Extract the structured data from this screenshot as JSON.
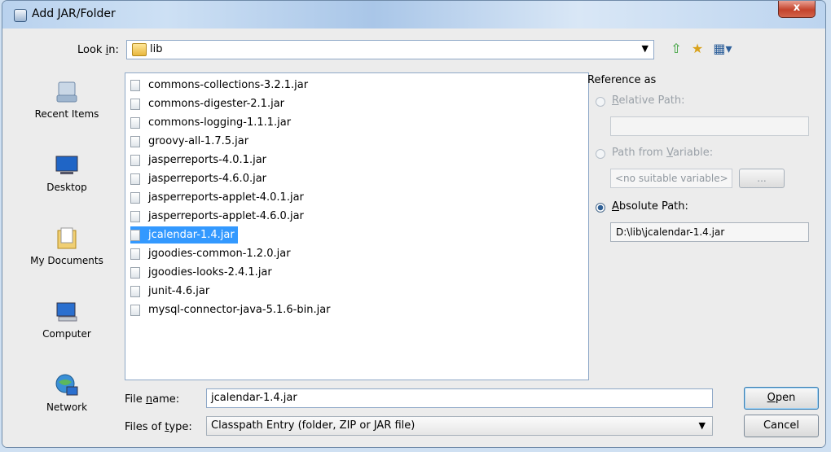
{
  "window": {
    "title": "Add JAR/Folder",
    "close_glyph": "x"
  },
  "lookin": {
    "label_prefix": "Look ",
    "label_key": "i",
    "label_suffix": "n:",
    "value": "lib",
    "arrow": "▼"
  },
  "toolbar": {
    "up_glyph": "⇧",
    "newfolder_glyph": "★",
    "view_glyph": "▦▾"
  },
  "places": [
    {
      "name": "recent-items",
      "label": "Recent Items"
    },
    {
      "name": "desktop",
      "label": "Desktop"
    },
    {
      "name": "my-documents",
      "label": "My Documents"
    },
    {
      "name": "computer",
      "label": "Computer"
    },
    {
      "name": "network",
      "label": "Network"
    }
  ],
  "files": [
    "commons-collections-3.2.1.jar",
    "commons-digester-2.1.jar",
    "commons-logging-1.1.1.jar",
    "groovy-all-1.7.5.jar",
    "jasperreports-4.0.1.jar",
    "jasperreports-4.6.0.jar",
    "jasperreports-applet-4.0.1.jar",
    "jasperreports-applet-4.6.0.jar",
    "jcalendar-1.4.jar",
    "jgoodies-common-1.2.0.jar",
    "jgoodies-looks-2.4.1.jar",
    "junit-4.6.jar",
    "mysql-connector-java-5.1.6-bin.jar"
  ],
  "selected_file_index": 8,
  "reference": {
    "title": "Reference as",
    "relative": {
      "key": "R",
      "rest": "elative Path:",
      "value": ""
    },
    "variable": {
      "prefix": "Path from ",
      "key": "V",
      "rest": "ariable:",
      "value": "<no suitable variable>",
      "browse": "..."
    },
    "absolute": {
      "key": "A",
      "rest": "bsolute Path:",
      "value": "D:\\lib\\jcalendar-1.4.jar"
    }
  },
  "filename": {
    "prefix": "File ",
    "key": "n",
    "rest": "ame:",
    "value": "jcalendar-1.4.jar"
  },
  "filetype": {
    "prefix": "Files of ",
    "key": "t",
    "rest": "ype:",
    "value": "Classpath Entry (folder, ZIP or JAR file)",
    "arrow": "▼"
  },
  "buttons": {
    "open_key": "O",
    "open_rest": "pen",
    "cancel": "Cancel"
  }
}
